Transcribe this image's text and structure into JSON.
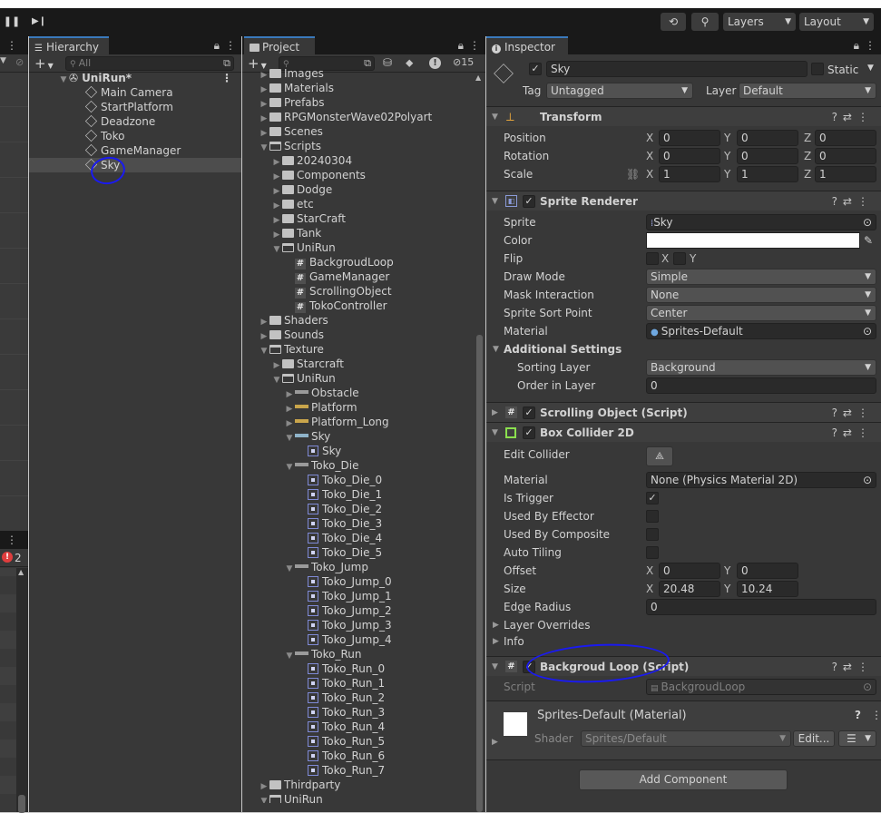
{
  "toolbar": {
    "play_icon": "pause-icon",
    "step_icon": "step-icon",
    "history_icon": "history-icon",
    "search_icon": "search-icon",
    "layers_label": "Layers",
    "layout_label": "Layout"
  },
  "hierarchy": {
    "tab_label": "Hierarchy",
    "search_placeholder": "All",
    "scene_name": "UniRun*",
    "items": [
      "Main Camera",
      "StartPlatform",
      "Deadzone",
      "Toko",
      "GameManager",
      "Sky"
    ],
    "selected": "Sky"
  },
  "console": {
    "error_count": "2"
  },
  "project": {
    "tab_label": "Project",
    "hidden_count": "15",
    "rows": [
      {
        "label": "Images",
        "type": "folder",
        "level": 0,
        "expanded": false
      },
      {
        "label": "Materials",
        "type": "folder",
        "level": 0,
        "expanded": false
      },
      {
        "label": "Prefabs",
        "type": "folder",
        "level": 0,
        "expanded": false
      },
      {
        "label": "RPGMonsterWave02Polyart",
        "type": "folder",
        "level": 0,
        "expanded": false
      },
      {
        "label": "Scenes",
        "type": "folder",
        "level": 0,
        "expanded": false
      },
      {
        "label": "Scripts",
        "type": "folder",
        "level": 0,
        "expanded": true
      },
      {
        "label": "20240304",
        "type": "folder",
        "level": 1,
        "expanded": false
      },
      {
        "label": "Components",
        "type": "folder",
        "level": 1,
        "expanded": false
      },
      {
        "label": "Dodge",
        "type": "folder",
        "level": 1,
        "expanded": false
      },
      {
        "label": "etc",
        "type": "folder",
        "level": 1,
        "expanded": false
      },
      {
        "label": "StarCraft",
        "type": "folder",
        "level": 1,
        "expanded": false
      },
      {
        "label": "Tank",
        "type": "folder",
        "level": 1,
        "expanded": false
      },
      {
        "label": "UniRun",
        "type": "folder",
        "level": 1,
        "expanded": true
      },
      {
        "label": "BackgroudLoop",
        "type": "script",
        "level": 2
      },
      {
        "label": "GameManager",
        "type": "script",
        "level": 2
      },
      {
        "label": "ScrollingObject",
        "type": "script",
        "level": 2
      },
      {
        "label": "TokoController",
        "type": "script",
        "level": 2
      },
      {
        "label": "Shaders",
        "type": "folder",
        "level": 0,
        "expanded": false
      },
      {
        "label": "Sounds",
        "type": "folder",
        "level": 0,
        "expanded": false
      },
      {
        "label": "Texture",
        "type": "folder",
        "level": 0,
        "expanded": true
      },
      {
        "label": "Starcraft",
        "type": "folder",
        "level": 1,
        "expanded": false
      },
      {
        "label": "UniRun",
        "type": "folder",
        "level": 1,
        "expanded": true
      },
      {
        "label": "Obstacle",
        "type": "texture",
        "level": 2,
        "expanded": false
      },
      {
        "label": "Platform",
        "type": "texture",
        "level": 2,
        "expanded": false
      },
      {
        "label": "Platform_Long",
        "type": "texture",
        "level": 2,
        "expanded": false
      },
      {
        "label": "Sky",
        "type": "texture",
        "level": 2,
        "expanded": true
      },
      {
        "label": "Sky",
        "type": "sprite",
        "level": 3
      },
      {
        "label": "Toko_Die",
        "type": "texture",
        "level": 2,
        "expanded": true
      },
      {
        "label": "Toko_Die_0",
        "type": "sprite",
        "level": 3
      },
      {
        "label": "Toko_Die_1",
        "type": "sprite",
        "level": 3
      },
      {
        "label": "Toko_Die_2",
        "type": "sprite",
        "level": 3
      },
      {
        "label": "Toko_Die_3",
        "type": "sprite",
        "level": 3
      },
      {
        "label": "Toko_Die_4",
        "type": "sprite",
        "level": 3
      },
      {
        "label": "Toko_Die_5",
        "type": "sprite",
        "level": 3
      },
      {
        "label": "Toko_Jump",
        "type": "texture",
        "level": 2,
        "expanded": true
      },
      {
        "label": "Toko_Jump_0",
        "type": "sprite",
        "level": 3
      },
      {
        "label": "Toko_Jump_1",
        "type": "sprite",
        "level": 3
      },
      {
        "label": "Toko_Jump_2",
        "type": "sprite",
        "level": 3
      },
      {
        "label": "Toko_Jump_3",
        "type": "sprite",
        "level": 3
      },
      {
        "label": "Toko_Jump_4",
        "type": "sprite",
        "level": 3
      },
      {
        "label": "Toko_Run",
        "type": "texture",
        "level": 2,
        "expanded": true
      },
      {
        "label": "Toko_Run_0",
        "type": "sprite",
        "level": 3
      },
      {
        "label": "Toko_Run_1",
        "type": "sprite",
        "level": 3
      },
      {
        "label": "Toko_Run_2",
        "type": "sprite",
        "level": 3
      },
      {
        "label": "Toko_Run_3",
        "type": "sprite",
        "level": 3
      },
      {
        "label": "Toko_Run_4",
        "type": "sprite",
        "level": 3
      },
      {
        "label": "Toko_Run_5",
        "type": "sprite",
        "level": 3
      },
      {
        "label": "Toko_Run_6",
        "type": "sprite",
        "level": 3
      },
      {
        "label": "Toko_Run_7",
        "type": "sprite",
        "level": 3
      },
      {
        "label": "Thirdparty",
        "type": "folder",
        "level": 0,
        "expanded": false
      },
      {
        "label": "UniRun",
        "type": "folder",
        "level": 0,
        "expanded": true
      }
    ]
  },
  "inspector": {
    "tab_label": "Inspector",
    "object_name": "Sky",
    "static_label": "Static",
    "tag_label": "Tag",
    "tag_value": "Untagged",
    "layer_label": "Layer",
    "layer_value": "Default",
    "transform": {
      "title": "Transform",
      "position_label": "Position",
      "position": [
        "0",
        "0",
        "0"
      ],
      "rotation_label": "Rotation",
      "rotation": [
        "0",
        "0",
        "0"
      ],
      "scale_label": "Scale",
      "scale": [
        "1",
        "1",
        "1"
      ]
    },
    "sprite_renderer": {
      "title": "Sprite Renderer",
      "sprite_label": "Sprite",
      "sprite_value": "Sky",
      "color_label": "Color",
      "color_value": "#ffffff",
      "flip_label": "Flip",
      "flip_x": "X",
      "flip_y": "Y",
      "draw_mode_label": "Draw Mode",
      "draw_mode_value": "Simple",
      "mask_label": "Mask Interaction",
      "mask_value": "None",
      "sort_point_label": "Sprite Sort Point",
      "sort_point_value": "Center",
      "material_label": "Material",
      "material_value": "Sprites-Default",
      "additional_label": "Additional Settings",
      "sorting_layer_label": "Sorting Layer",
      "sorting_layer_value": "Background",
      "order_label": "Order in Layer",
      "order_value": "0"
    },
    "scrolling_object": {
      "title": "Scrolling Object (Script)"
    },
    "box_collider": {
      "title": "Box Collider 2D",
      "edit_label": "Edit Collider",
      "material_label": "Material",
      "material_value": "None (Physics Material 2D)",
      "trigger_label": "Is Trigger",
      "effector_label": "Used By Effector",
      "composite_label": "Used By Composite",
      "tiling_label": "Auto Tiling",
      "offset_label": "Offset",
      "offset": [
        "0",
        "0"
      ],
      "size_label": "Size",
      "size": [
        "20.48",
        "10.24"
      ],
      "edge_label": "Edge Radius",
      "edge_value": "0",
      "overrides_label": "Layer Overrides",
      "info_label": "Info"
    },
    "background_loop": {
      "title": "Backgroud Loop (Script)",
      "script_label": "Script",
      "script_value": "BackgroudLoop"
    },
    "material_preview": {
      "name": "Sprites-Default (Material)",
      "shader_label": "Shader",
      "shader_value": "Sprites/Default",
      "edit_label": "Edit..."
    },
    "add_component_label": "Add Component"
  },
  "axes": {
    "x": "X",
    "y": "Y",
    "z": "Z"
  }
}
